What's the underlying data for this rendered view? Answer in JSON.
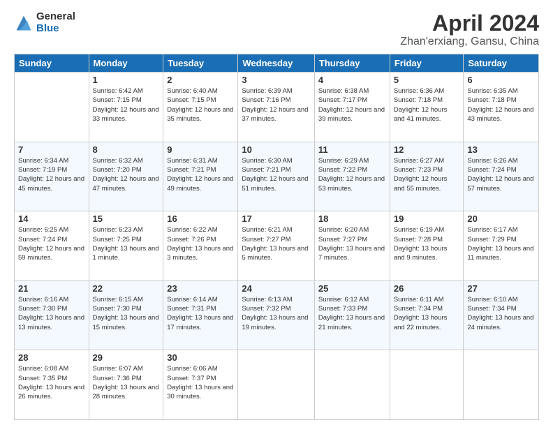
{
  "logo": {
    "general": "General",
    "blue": "Blue"
  },
  "title": "April 2024",
  "subtitle": "Zhan'erxiang, Gansu, China",
  "calendar": {
    "headers": [
      "Sunday",
      "Monday",
      "Tuesday",
      "Wednesday",
      "Thursday",
      "Friday",
      "Saturday"
    ],
    "weeks": [
      [
        {
          "day": "",
          "info": ""
        },
        {
          "day": "1",
          "info": "Sunrise: 6:42 AM\nSunset: 7:15 PM\nDaylight: 12 hours\nand 33 minutes."
        },
        {
          "day": "2",
          "info": "Sunrise: 6:40 AM\nSunset: 7:15 PM\nDaylight: 12 hours\nand 35 minutes."
        },
        {
          "day": "3",
          "info": "Sunrise: 6:39 AM\nSunset: 7:16 PM\nDaylight: 12 hours\nand 37 minutes."
        },
        {
          "day": "4",
          "info": "Sunrise: 6:38 AM\nSunset: 7:17 PM\nDaylight: 12 hours\nand 39 minutes."
        },
        {
          "day": "5",
          "info": "Sunrise: 6:36 AM\nSunset: 7:18 PM\nDaylight: 12 hours\nand 41 minutes."
        },
        {
          "day": "6",
          "info": "Sunrise: 6:35 AM\nSunset: 7:18 PM\nDaylight: 12 hours\nand 43 minutes."
        }
      ],
      [
        {
          "day": "7",
          "info": "Sunrise: 6:34 AM\nSunset: 7:19 PM\nDaylight: 12 hours\nand 45 minutes."
        },
        {
          "day": "8",
          "info": "Sunrise: 6:32 AM\nSunset: 7:20 PM\nDaylight: 12 hours\nand 47 minutes."
        },
        {
          "day": "9",
          "info": "Sunrise: 6:31 AM\nSunset: 7:21 PM\nDaylight: 12 hours\nand 49 minutes."
        },
        {
          "day": "10",
          "info": "Sunrise: 6:30 AM\nSunset: 7:21 PM\nDaylight: 12 hours\nand 51 minutes."
        },
        {
          "day": "11",
          "info": "Sunrise: 6:29 AM\nSunset: 7:22 PM\nDaylight: 12 hours\nand 53 minutes."
        },
        {
          "day": "12",
          "info": "Sunrise: 6:27 AM\nSunset: 7:23 PM\nDaylight: 12 hours\nand 55 minutes."
        },
        {
          "day": "13",
          "info": "Sunrise: 6:26 AM\nSunset: 7:24 PM\nDaylight: 12 hours\nand 57 minutes."
        }
      ],
      [
        {
          "day": "14",
          "info": "Sunrise: 6:25 AM\nSunset: 7:24 PM\nDaylight: 12 hours\nand 59 minutes."
        },
        {
          "day": "15",
          "info": "Sunrise: 6:23 AM\nSunset: 7:25 PM\nDaylight: 13 hours\nand 1 minute."
        },
        {
          "day": "16",
          "info": "Sunrise: 6:22 AM\nSunset: 7:26 PM\nDaylight: 13 hours\nand 3 minutes."
        },
        {
          "day": "17",
          "info": "Sunrise: 6:21 AM\nSunset: 7:27 PM\nDaylight: 13 hours\nand 5 minutes."
        },
        {
          "day": "18",
          "info": "Sunrise: 6:20 AM\nSunset: 7:27 PM\nDaylight: 13 hours\nand 7 minutes."
        },
        {
          "day": "19",
          "info": "Sunrise: 6:19 AM\nSunset: 7:28 PM\nDaylight: 13 hours\nand 9 minutes."
        },
        {
          "day": "20",
          "info": "Sunrise: 6:17 AM\nSunset: 7:29 PM\nDaylight: 13 hours\nand 11 minutes."
        }
      ],
      [
        {
          "day": "21",
          "info": "Sunrise: 6:16 AM\nSunset: 7:30 PM\nDaylight: 13 hours\nand 13 minutes."
        },
        {
          "day": "22",
          "info": "Sunrise: 6:15 AM\nSunset: 7:30 PM\nDaylight: 13 hours\nand 15 minutes."
        },
        {
          "day": "23",
          "info": "Sunrise: 6:14 AM\nSunset: 7:31 PM\nDaylight: 13 hours\nand 17 minutes."
        },
        {
          "day": "24",
          "info": "Sunrise: 6:13 AM\nSunset: 7:32 PM\nDaylight: 13 hours\nand 19 minutes."
        },
        {
          "day": "25",
          "info": "Sunrise: 6:12 AM\nSunset: 7:33 PM\nDaylight: 13 hours\nand 21 minutes."
        },
        {
          "day": "26",
          "info": "Sunrise: 6:11 AM\nSunset: 7:34 PM\nDaylight: 13 hours\nand 22 minutes."
        },
        {
          "day": "27",
          "info": "Sunrise: 6:10 AM\nSunset: 7:34 PM\nDaylight: 13 hours\nand 24 minutes."
        }
      ],
      [
        {
          "day": "28",
          "info": "Sunrise: 6:08 AM\nSunset: 7:35 PM\nDaylight: 13 hours\nand 26 minutes."
        },
        {
          "day": "29",
          "info": "Sunrise: 6:07 AM\nSunset: 7:36 PM\nDaylight: 13 hours\nand 28 minutes."
        },
        {
          "day": "30",
          "info": "Sunrise: 6:06 AM\nSunset: 7:37 PM\nDaylight: 13 hours\nand 30 minutes."
        },
        {
          "day": "",
          "info": ""
        },
        {
          "day": "",
          "info": ""
        },
        {
          "day": "",
          "info": ""
        },
        {
          "day": "",
          "info": ""
        }
      ]
    ]
  }
}
